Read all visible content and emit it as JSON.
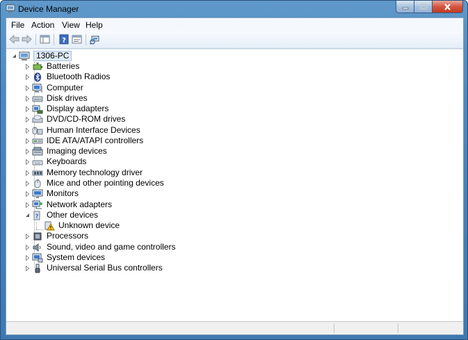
{
  "window": {
    "title": "Device Manager"
  },
  "menu": [
    "File",
    "Action",
    "View",
    "Help"
  ],
  "toolbar": {
    "buttons": [
      "back-arrow-icon",
      "forward-arrow-icon",
      "show-hide-console-tree-icon",
      "help-icon",
      "properties-icon",
      "scan-hardware-icon"
    ]
  },
  "tree": {
    "root": "1306-PC",
    "categories": [
      {
        "label": "Batteries",
        "icon": "battery-icon",
        "expanded": false
      },
      {
        "label": "Bluetooth Radios",
        "icon": "bluetooth-icon",
        "expanded": false
      },
      {
        "label": "Computer",
        "icon": "computer-icon",
        "expanded": false
      },
      {
        "label": "Disk drives",
        "icon": "disk-drive-icon",
        "expanded": false
      },
      {
        "label": "Display adapters",
        "icon": "display-adapter-icon",
        "expanded": false
      },
      {
        "label": "DVD/CD-ROM drives",
        "icon": "dvd-drive-icon",
        "expanded": false
      },
      {
        "label": "Human Interface Devices",
        "icon": "hid-icon",
        "expanded": false
      },
      {
        "label": "IDE ATA/ATAPI controllers",
        "icon": "ide-controller-icon",
        "expanded": false
      },
      {
        "label": "Imaging devices",
        "icon": "imaging-device-icon",
        "expanded": false
      },
      {
        "label": "Keyboards",
        "icon": "keyboard-icon",
        "expanded": false
      },
      {
        "label": "Memory technology driver",
        "icon": "memory-icon",
        "expanded": false
      },
      {
        "label": "Mice and other pointing devices",
        "icon": "mouse-icon",
        "expanded": false
      },
      {
        "label": "Monitors",
        "icon": "monitor-icon",
        "expanded": false
      },
      {
        "label": "Network adapters",
        "icon": "network-adapter-icon",
        "expanded": false
      },
      {
        "label": "Other devices",
        "icon": "other-devices-icon",
        "expanded": true,
        "children": [
          {
            "label": "Unknown device",
            "icon": "unknown-device-warning-icon"
          }
        ]
      },
      {
        "label": "Processors",
        "icon": "processor-icon",
        "expanded": false
      },
      {
        "label": "Sound, video and game controllers",
        "icon": "sound-icon",
        "expanded": false
      },
      {
        "label": "System devices",
        "icon": "system-devices-icon",
        "expanded": false
      },
      {
        "label": "Universal Serial Bus controllers",
        "icon": "usb-icon",
        "expanded": false
      }
    ]
  },
  "colors": {
    "title_bar": "#4d88bf",
    "close_button": "#c23a22",
    "selection": "#dfeaf7"
  }
}
